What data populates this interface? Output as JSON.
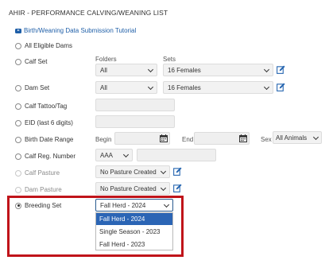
{
  "title": "AHIR - PERFORMANCE CALVING/WEANING LIST",
  "tutorial_link": "Birth/Weaning Data Submission Tutorial",
  "colors": {
    "accent": "#1f5fa8",
    "highlight_border": "#c0141a",
    "selected_option": "#2b65b5"
  },
  "options": {
    "all_eligible_dams": "All Eligible Dams",
    "calf_set": "Calf Set",
    "dam_set": "Dam Set",
    "calf_tattoo": "Calf Tattoo/Tag",
    "eid": "EID (last 6 digits)",
    "birth_date_range": "Birth Date Range",
    "calf_reg_number": "Calf Reg. Number",
    "calf_pasture": "Calf Pasture",
    "dam_pasture": "Dam Pasture",
    "breeding_set": "Breeding Set"
  },
  "headers": {
    "folders": "Folders",
    "sets": "Sets"
  },
  "calf_set": {
    "folder": "All",
    "set": "16 Females"
  },
  "dam_set": {
    "folder": "All",
    "set": "16 Females"
  },
  "birth_date": {
    "begin_label": "Begin",
    "end_label": "End",
    "sex_label": "Sex",
    "sex_value": "All Animals"
  },
  "calf_reg": {
    "prefix": "AAA"
  },
  "calf_pasture": {
    "value": "No Pasture Created"
  },
  "dam_pasture": {
    "value": "No Pasture Created"
  },
  "breeding_set": {
    "selected": "Fall Herd - 2024",
    "options": [
      "Fall Herd - 2024",
      "Single Season - 2023",
      "Fall Herd - 2023"
    ]
  }
}
